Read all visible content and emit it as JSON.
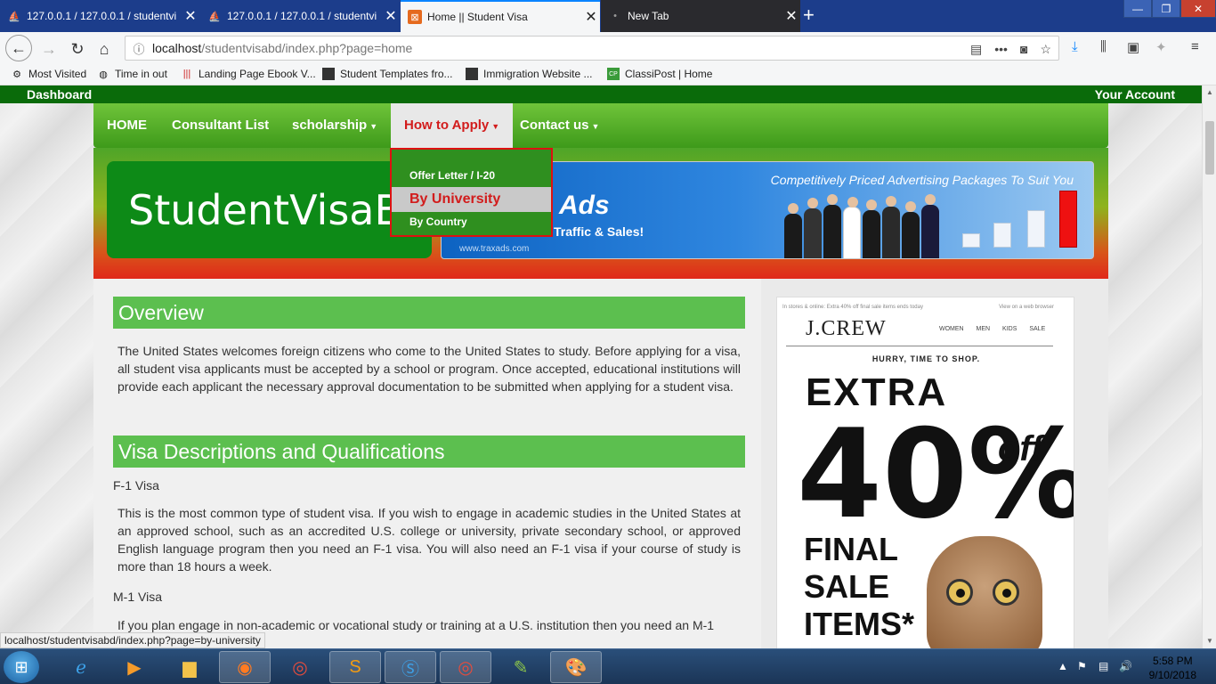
{
  "browser": {
    "tabs": [
      {
        "title": "127.0.0.1 / 127.0.0.1 / studentvi",
        "active": false
      },
      {
        "title": "127.0.0.1 / 127.0.0.1 / studentvi",
        "active": false
      },
      {
        "title": "Home || Student Visa",
        "active": true
      },
      {
        "title": "New Tab",
        "active": false
      }
    ],
    "url_host": "localhost",
    "url_path": "/studentvisabd/index.php?page=home",
    "bookmarks": [
      "Most Visited",
      "Time in out",
      "Landing Page Ebook V...",
      "Student Templates fro...",
      "Immigration Website ...",
      "ClassiPost | Home"
    ],
    "status_url": "localhost/studentvisabd/index.php?page=by-university"
  },
  "site": {
    "topstrip": {
      "left": "Dashboard",
      "right": "Your Account"
    },
    "nav": [
      "HOME",
      "Consultant List",
      "scholarship",
      "How to Apply",
      "Contact us"
    ],
    "dropdown": [
      "Offer Letter / I-20",
      "By University",
      "By Country"
    ],
    "logo_text": "StudentVisaBD",
    "banner": {
      "tagline": "Competitively Priced Advertising Packages To Suit You",
      "brand": "Ads",
      "slogan": "Traffic & Sales!",
      "website": "www.traxads.com"
    },
    "overview_title": "Overview",
    "overview_text": "The United States welcomes foreign citizens who come to the United States to study. Before applying for a visa, all student visa applicants must be accepted by a school or program. Once accepted, educational institutions will provide each applicant the necessary approval documentation to be submitted when applying for a student visa.",
    "visa_title": "Visa Descriptions and Qualifications",
    "f1_label": "F-1 Visa",
    "f1_text": "This is the most common type of student visa. If you wish to engage in academic studies in the United States at an approved school, such as an accredited U.S. college or university, private secondary school, or approved English language program then you need an F-1 visa. You will also need an F-1 visa if your course of study is more than 18 hours a week.",
    "m1_label": "M-1 Visa",
    "m1_text": "If you plan engage in non-academic or vocational study or training at a U.S. institution then you need an M-1"
  },
  "ad": {
    "top_left": "In stores & online: Extra 40% off final sale items ends today",
    "top_right": "View on a web browser",
    "brand": "J.CREW",
    "menu": "WOMEN MEN KIDS SALE",
    "hurry": "HURRY, TIME TO SHOP.",
    "extra": "EXTRA",
    "percent": "40%",
    "off": "off",
    "final": "FINAL",
    "sale": "SALE",
    "items": "ITEMS*"
  },
  "taskbar": {
    "time": "5:58 PM",
    "date": "9/10/2018"
  }
}
